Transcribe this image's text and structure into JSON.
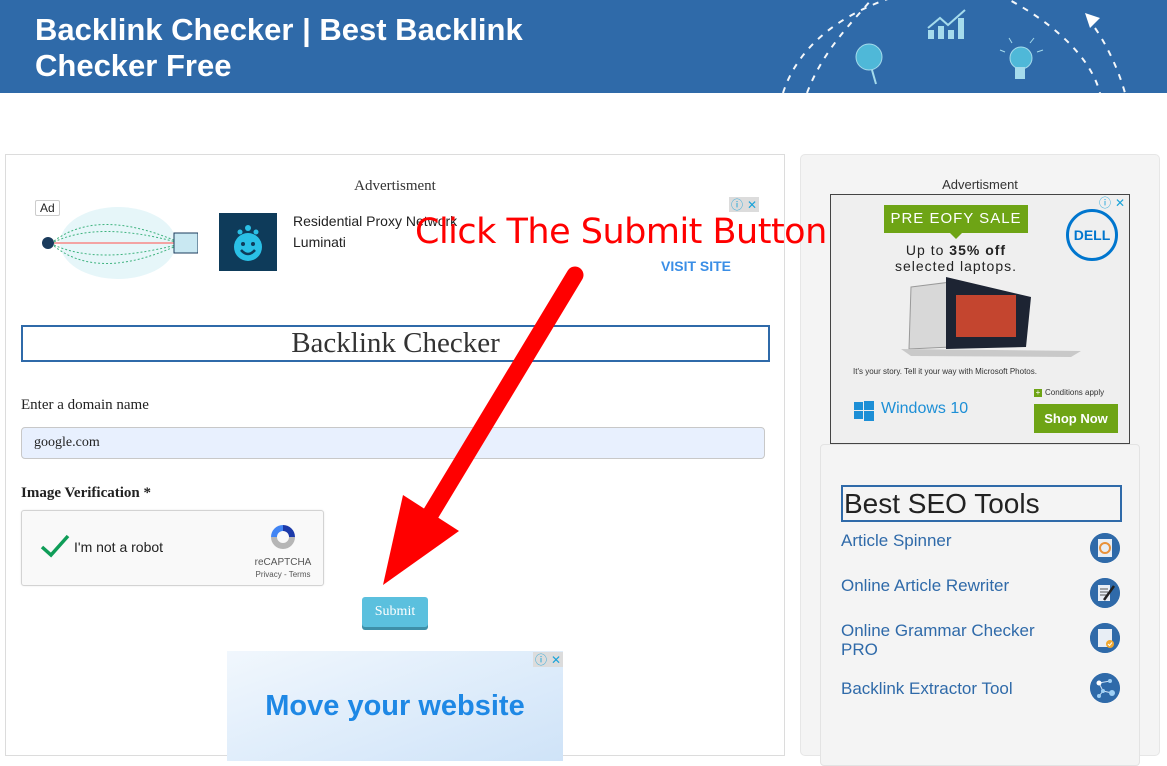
{
  "header": {
    "title": "Backlink Checker | Best Backlink Checker Free"
  },
  "main": {
    "ad_caption": "Advertisment",
    "top_ad": {
      "badge": "Ad",
      "title": "Residential Proxy Network",
      "brand": "Luminati",
      "cta": "VISIT SITE"
    },
    "tool_heading": "Backlink Checker",
    "domain_label": "Enter a domain name",
    "domain_value": "google.com",
    "verification_label": "Image Verification *",
    "recaptcha": {
      "text": "I'm not a robot",
      "brand": "reCAPTCHA",
      "links": "Privacy - Terms",
      "checked": true
    },
    "submit_label": "Submit",
    "bottom_ad": {
      "headline": "Move your website"
    }
  },
  "sidebar": {
    "ad_caption": "Advertisment",
    "dell_ad": {
      "sale_badge": "PRE EOFY SALE",
      "offer_line1_prefix": "Up to ",
      "offer_highlight": "35% off",
      "offer_line2": "selected laptops.",
      "brand": "DELL",
      "story": "It's your story. Tell it your way with Microsoft Photos.",
      "windows": "Windows 10",
      "conditions": "Conditions apply",
      "cta": "Shop Now"
    },
    "seo_heading": "Best SEO Tools",
    "seo_tools": [
      {
        "label": "Article Spinner",
        "icon": "spinner-icon"
      },
      {
        "label": "Online Article Rewriter",
        "icon": "quill-document-icon"
      },
      {
        "label": "Online Grammar Checker PRO",
        "icon": "document-check-icon"
      },
      {
        "label": "Backlink Extractor Tool",
        "icon": "network-nodes-icon"
      }
    ]
  },
  "annotation": {
    "text": "Click The Submit Button",
    "color": "#ff0000"
  },
  "colors": {
    "header_bg": "#2f6aa9",
    "submit_bg": "#5bc0de",
    "link": "#2f6aa9",
    "dell_green": "#6ea415"
  }
}
